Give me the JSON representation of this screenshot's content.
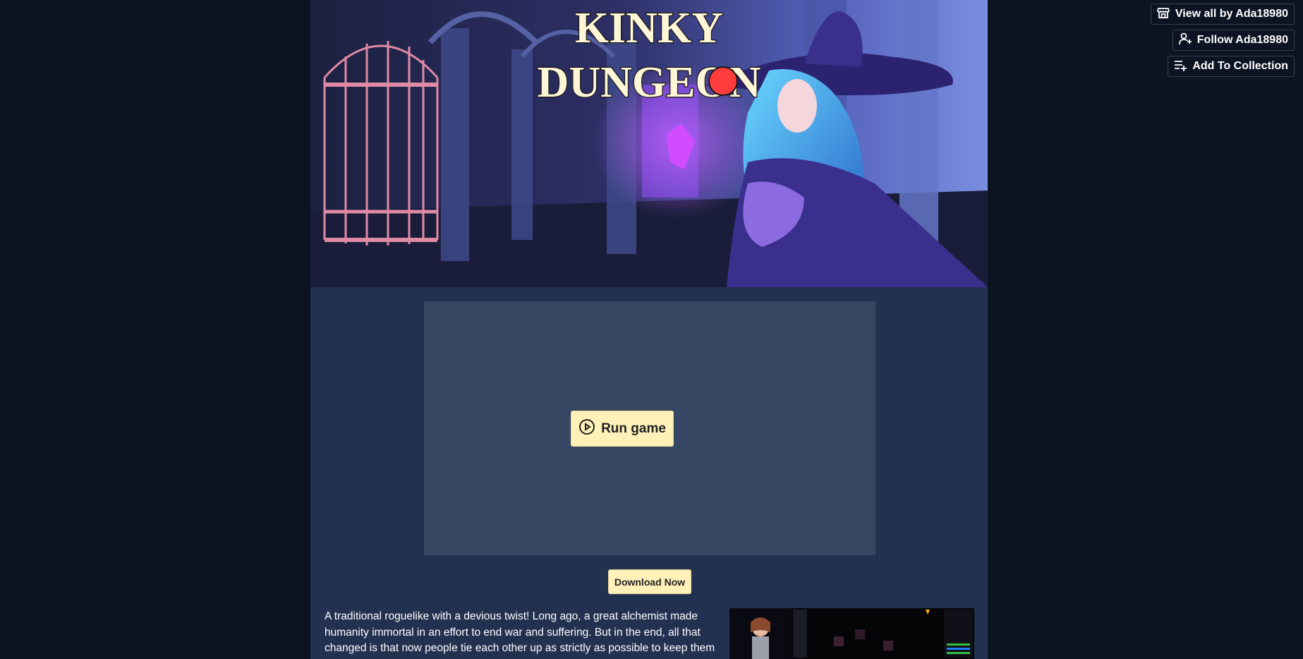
{
  "user_tools": {
    "view_all_label": "View all by Ada18980",
    "follow_label": "Follow Ada18980",
    "collection_label": "Add To Collection"
  },
  "banner": {
    "title_line1": "KINKY",
    "title_line2": "DUNGEON"
  },
  "game": {
    "run_label": "Run game",
    "download_label": "Download Now"
  },
  "description": {
    "text": "A traditional roguelike with a devious twist! Long ago, a great alchemist made humanity immortal in an effort to end war and suffering. But in the end, all that changed is that now people tie each other up as strictly as possible to keep them"
  },
  "colors": {
    "page_bg": "#0c1322",
    "column_bg": "#233150",
    "embed_bg": "#364763",
    "button_bg": "#fff1b8"
  }
}
